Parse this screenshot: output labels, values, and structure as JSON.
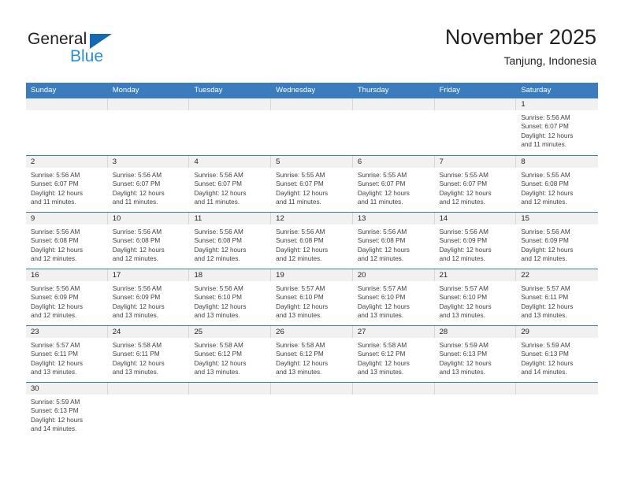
{
  "brand": {
    "name_part1": "General",
    "name_part2": "Blue",
    "triangle_color": "#1668b3",
    "blue_color": "#2a8fd4"
  },
  "header": {
    "title": "November 2025",
    "subtitle": "Tanjung, Indonesia"
  },
  "colors": {
    "header_bar": "#3a7cbe",
    "daynum_band": "#f1f1f1",
    "week_separator": "#3a7cbe",
    "column_separator": "#d7d7d7"
  },
  "weekdays": [
    "Sunday",
    "Monday",
    "Tuesday",
    "Wednesday",
    "Thursday",
    "Friday",
    "Saturday"
  ],
  "weeks": [
    [
      {
        "day": "",
        "lines": []
      },
      {
        "day": "",
        "lines": []
      },
      {
        "day": "",
        "lines": []
      },
      {
        "day": "",
        "lines": []
      },
      {
        "day": "",
        "lines": []
      },
      {
        "day": "",
        "lines": []
      },
      {
        "day": "1",
        "lines": [
          "Sunrise: 5:56 AM",
          "Sunset: 6:07 PM",
          "Daylight: 12 hours",
          "and 11 minutes."
        ]
      }
    ],
    [
      {
        "day": "2",
        "lines": [
          "Sunrise: 5:56 AM",
          "Sunset: 6:07 PM",
          "Daylight: 12 hours",
          "and 11 minutes."
        ]
      },
      {
        "day": "3",
        "lines": [
          "Sunrise: 5:56 AM",
          "Sunset: 6:07 PM",
          "Daylight: 12 hours",
          "and 11 minutes."
        ]
      },
      {
        "day": "4",
        "lines": [
          "Sunrise: 5:56 AM",
          "Sunset: 6:07 PM",
          "Daylight: 12 hours",
          "and 11 minutes."
        ]
      },
      {
        "day": "5",
        "lines": [
          "Sunrise: 5:55 AM",
          "Sunset: 6:07 PM",
          "Daylight: 12 hours",
          "and 11 minutes."
        ]
      },
      {
        "day": "6",
        "lines": [
          "Sunrise: 5:55 AM",
          "Sunset: 6:07 PM",
          "Daylight: 12 hours",
          "and 11 minutes."
        ]
      },
      {
        "day": "7",
        "lines": [
          "Sunrise: 5:55 AM",
          "Sunset: 6:07 PM",
          "Daylight: 12 hours",
          "and 12 minutes."
        ]
      },
      {
        "day": "8",
        "lines": [
          "Sunrise: 5:55 AM",
          "Sunset: 6:08 PM",
          "Daylight: 12 hours",
          "and 12 minutes."
        ]
      }
    ],
    [
      {
        "day": "9",
        "lines": [
          "Sunrise: 5:56 AM",
          "Sunset: 6:08 PM",
          "Daylight: 12 hours",
          "and 12 minutes."
        ]
      },
      {
        "day": "10",
        "lines": [
          "Sunrise: 5:56 AM",
          "Sunset: 6:08 PM",
          "Daylight: 12 hours",
          "and 12 minutes."
        ]
      },
      {
        "day": "11",
        "lines": [
          "Sunrise: 5:56 AM",
          "Sunset: 6:08 PM",
          "Daylight: 12 hours",
          "and 12 minutes."
        ]
      },
      {
        "day": "12",
        "lines": [
          "Sunrise: 5:56 AM",
          "Sunset: 6:08 PM",
          "Daylight: 12 hours",
          "and 12 minutes."
        ]
      },
      {
        "day": "13",
        "lines": [
          "Sunrise: 5:56 AM",
          "Sunset: 6:08 PM",
          "Daylight: 12 hours",
          "and 12 minutes."
        ]
      },
      {
        "day": "14",
        "lines": [
          "Sunrise: 5:56 AM",
          "Sunset: 6:09 PM",
          "Daylight: 12 hours",
          "and 12 minutes."
        ]
      },
      {
        "day": "15",
        "lines": [
          "Sunrise: 5:56 AM",
          "Sunset: 6:09 PM",
          "Daylight: 12 hours",
          "and 12 minutes."
        ]
      }
    ],
    [
      {
        "day": "16",
        "lines": [
          "Sunrise: 5:56 AM",
          "Sunset: 6:09 PM",
          "Daylight: 12 hours",
          "and 12 minutes."
        ]
      },
      {
        "day": "17",
        "lines": [
          "Sunrise: 5:56 AM",
          "Sunset: 6:09 PM",
          "Daylight: 12 hours",
          "and 13 minutes."
        ]
      },
      {
        "day": "18",
        "lines": [
          "Sunrise: 5:56 AM",
          "Sunset: 6:10 PM",
          "Daylight: 12 hours",
          "and 13 minutes."
        ]
      },
      {
        "day": "19",
        "lines": [
          "Sunrise: 5:57 AM",
          "Sunset: 6:10 PM",
          "Daylight: 12 hours",
          "and 13 minutes."
        ]
      },
      {
        "day": "20",
        "lines": [
          "Sunrise: 5:57 AM",
          "Sunset: 6:10 PM",
          "Daylight: 12 hours",
          "and 13 minutes."
        ]
      },
      {
        "day": "21",
        "lines": [
          "Sunrise: 5:57 AM",
          "Sunset: 6:10 PM",
          "Daylight: 12 hours",
          "and 13 minutes."
        ]
      },
      {
        "day": "22",
        "lines": [
          "Sunrise: 5:57 AM",
          "Sunset: 6:11 PM",
          "Daylight: 12 hours",
          "and 13 minutes."
        ]
      }
    ],
    [
      {
        "day": "23",
        "lines": [
          "Sunrise: 5:57 AM",
          "Sunset: 6:11 PM",
          "Daylight: 12 hours",
          "and 13 minutes."
        ]
      },
      {
        "day": "24",
        "lines": [
          "Sunrise: 5:58 AM",
          "Sunset: 6:11 PM",
          "Daylight: 12 hours",
          "and 13 minutes."
        ]
      },
      {
        "day": "25",
        "lines": [
          "Sunrise: 5:58 AM",
          "Sunset: 6:12 PM",
          "Daylight: 12 hours",
          "and 13 minutes."
        ]
      },
      {
        "day": "26",
        "lines": [
          "Sunrise: 5:58 AM",
          "Sunset: 6:12 PM",
          "Daylight: 12 hours",
          "and 13 minutes."
        ]
      },
      {
        "day": "27",
        "lines": [
          "Sunrise: 5:58 AM",
          "Sunset: 6:12 PM",
          "Daylight: 12 hours",
          "and 13 minutes."
        ]
      },
      {
        "day": "28",
        "lines": [
          "Sunrise: 5:59 AM",
          "Sunset: 6:13 PM",
          "Daylight: 12 hours",
          "and 13 minutes."
        ]
      },
      {
        "day": "29",
        "lines": [
          "Sunrise: 5:59 AM",
          "Sunset: 6:13 PM",
          "Daylight: 12 hours",
          "and 14 minutes."
        ]
      }
    ],
    [
      {
        "day": "30",
        "lines": [
          "Sunrise: 5:59 AM",
          "Sunset: 6:13 PM",
          "Daylight: 12 hours",
          "and 14 minutes."
        ]
      },
      {
        "day": "",
        "lines": []
      },
      {
        "day": "",
        "lines": []
      },
      {
        "day": "",
        "lines": []
      },
      {
        "day": "",
        "lines": []
      },
      {
        "day": "",
        "lines": []
      },
      {
        "day": "",
        "lines": []
      }
    ]
  ]
}
